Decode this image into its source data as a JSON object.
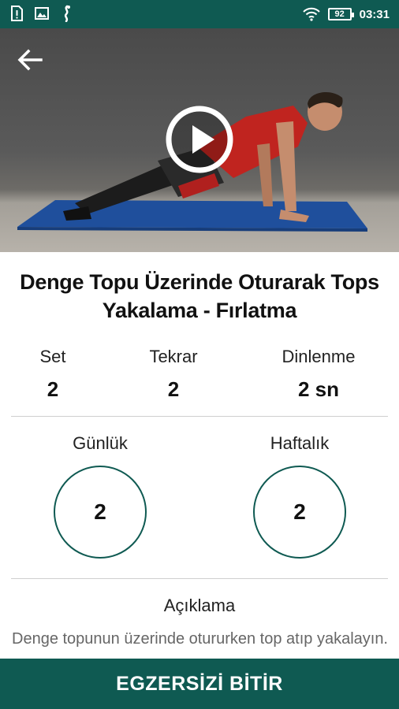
{
  "status_bar": {
    "battery": "92",
    "time": "03:31",
    "left_icons": [
      "sim-alert-icon",
      "image-icon",
      "fitness-app-icon"
    ],
    "right_icons": [
      "wifi-icon",
      "battery-icon"
    ]
  },
  "video": {
    "back_icon": "arrow-left-icon",
    "play_icon": "play-circle-icon"
  },
  "exercise": {
    "title_line1": "Denge Topu Üzerinde Oturarak Tops",
    "title_line2": "Yakalama - Fırlatma"
  },
  "stats": {
    "set_label": "Set",
    "set_value": "2",
    "rep_label": "Tekrar",
    "rep_value": "2",
    "rest_label": "Dinlenme",
    "rest_value": "2 sn"
  },
  "frequency": {
    "daily_label": "Günlük",
    "daily_value": "2",
    "weekly_label": "Haftalık",
    "weekly_value": "2"
  },
  "description": {
    "title": "Açıklama",
    "text": "Denge topunun üzerinde otururken top atıp yakalayın."
  },
  "footer": {
    "finish_label": "EGZERSİZİ BİTİR"
  },
  "colors": {
    "brand": "#0f5a52",
    "divider": "#cfcfcf"
  }
}
